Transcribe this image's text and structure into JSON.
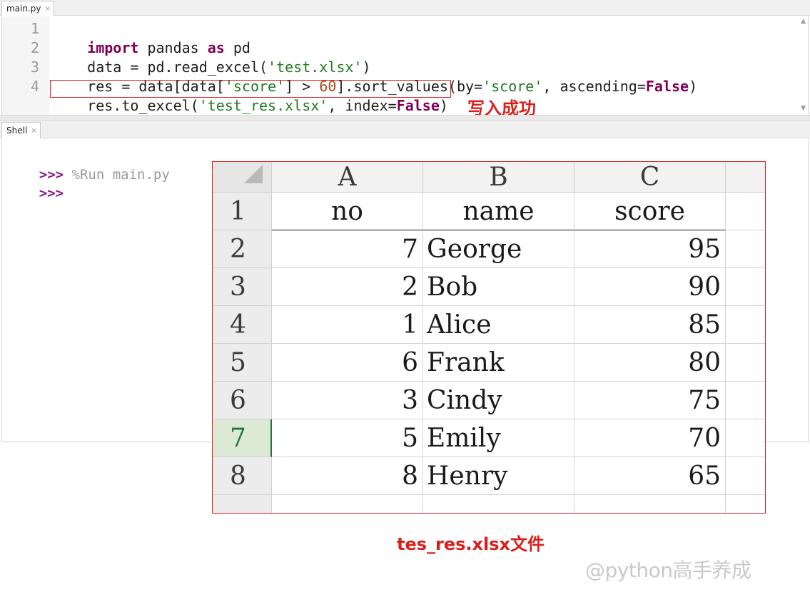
{
  "editor": {
    "tab_label": "main.py",
    "tab_close": "×",
    "line_numbers": [
      "1",
      "2",
      "3",
      "4"
    ],
    "lines": [
      [
        {
          "t": "import",
          "c": "kw"
        },
        {
          "t": " pandas ",
          "c": ""
        },
        {
          "t": "as",
          "c": "kw"
        },
        {
          "t": " pd",
          "c": ""
        }
      ],
      [
        {
          "t": "data = pd.read_excel(",
          "c": ""
        },
        {
          "t": "'test.xlsx'",
          "c": "str"
        },
        {
          "t": ")",
          "c": ""
        }
      ],
      [
        {
          "t": "res = data[data[",
          "c": ""
        },
        {
          "t": "'score'",
          "c": "str"
        },
        {
          "t": "] > ",
          "c": ""
        },
        {
          "t": "60",
          "c": "num"
        },
        {
          "t": "].sort_values(by=",
          "c": ""
        },
        {
          "t": "'score'",
          "c": "str"
        },
        {
          "t": ", ascending=",
          "c": ""
        },
        {
          "t": "False",
          "c": "kwc"
        },
        {
          "t": ")",
          "c": ""
        }
      ],
      [
        {
          "t": "res.to_excel(",
          "c": ""
        },
        {
          "t": "'test_res.xlsx'",
          "c": "str"
        },
        {
          "t": ", index=",
          "c": ""
        },
        {
          "t": "False",
          "c": "kwc"
        },
        {
          "t": ")",
          "c": ""
        }
      ]
    ]
  },
  "annotation_success": "写入成功",
  "shell": {
    "tab_label": "Shell",
    "tab_close": "×",
    "prompt": ">>>",
    "command": " %Run main.py"
  },
  "spreadsheet": {
    "columns": [
      "A",
      "B",
      "C"
    ],
    "row_numbers": [
      "1",
      "2",
      "3",
      "4",
      "5",
      "6",
      "7",
      "8"
    ],
    "active_row": "7",
    "header": [
      "no",
      "name",
      "score"
    ],
    "rows": [
      [
        "7",
        "George",
        "95"
      ],
      [
        "2",
        "Bob",
        "90"
      ],
      [
        "1",
        "Alice",
        "85"
      ],
      [
        "6",
        "Frank",
        "80"
      ],
      [
        "3",
        "Cindy",
        "75"
      ],
      [
        "5",
        "Emily",
        "70"
      ],
      [
        "8",
        "Henry",
        "65"
      ]
    ]
  },
  "annotation_file": "tes_res.xlsx文件",
  "watermark": "@python高手养成",
  "colors": {
    "annotation_red": "#d8201b",
    "keyword": "#7f0055",
    "string": "#1f7a1f",
    "number": "#b0481b"
  }
}
